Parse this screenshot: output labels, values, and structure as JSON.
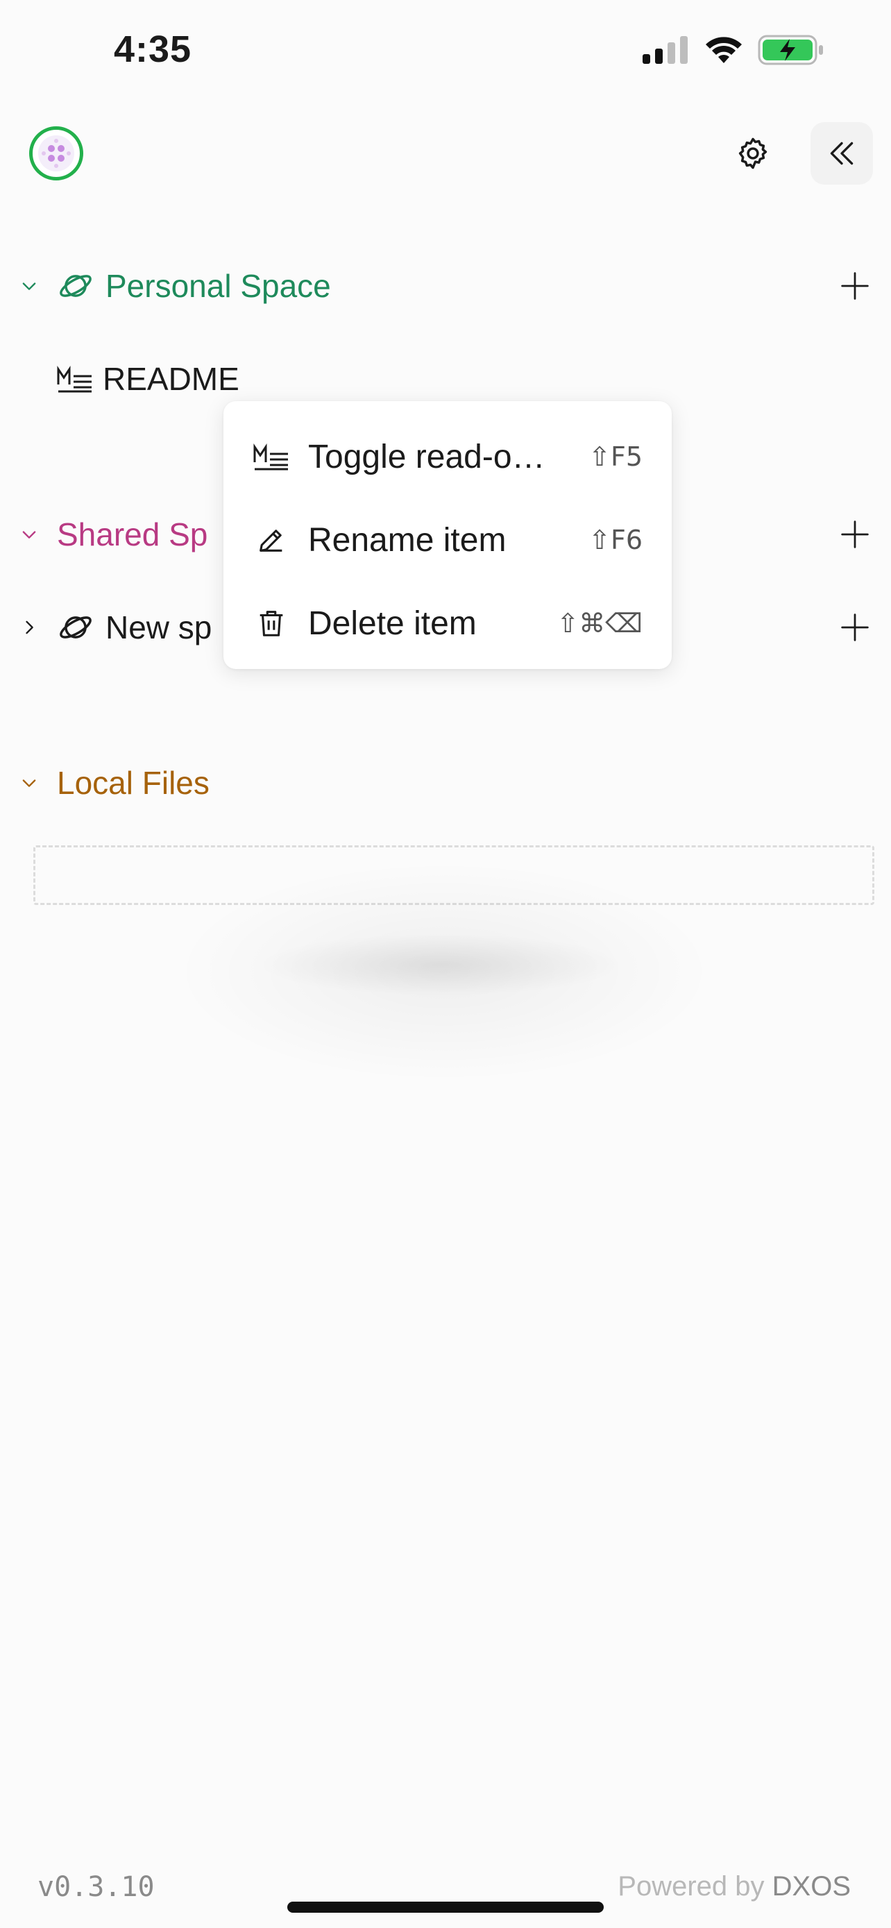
{
  "status_bar": {
    "time": "4:35"
  },
  "sidebar": {
    "personal_space": {
      "title": "Personal Space",
      "color": "#1e8a5b"
    },
    "readme": {
      "label": "README"
    },
    "shared_space": {
      "title": "Shared Sp",
      "color": "#b83a83"
    },
    "new_space": {
      "label": "New sp"
    },
    "local_files": {
      "title": "Local Files",
      "color": "#a6620b"
    }
  },
  "context_menu": {
    "items": [
      {
        "label": "Toggle read-o…",
        "shortcut": "⇧F5",
        "icon": "markdown-icon"
      },
      {
        "label": "Rename item",
        "shortcut": "⇧F6",
        "icon": "pencil-icon"
      },
      {
        "label": "Delete item",
        "shortcut": "⇧⌘⌫",
        "icon": "trash-icon"
      }
    ]
  },
  "footer": {
    "version": "v0.3.10",
    "powered_by": "Powered by",
    "brand": "DXOS"
  }
}
